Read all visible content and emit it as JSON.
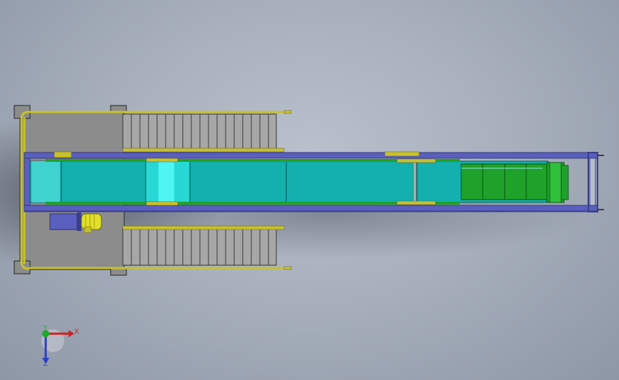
{
  "viewport": {
    "background_top": "#b9c0cc",
    "background_edge": "#8e97a6"
  },
  "model": {
    "colors": {
      "frame": "#5a5fbf",
      "frame_dark": "#3a3f8a",
      "belt": "#13b3b0",
      "belt_light": "#4ff0ee",
      "green_section": "#1fa22a",
      "green_dark": "#0f6e16",
      "rail": "#c8c22a",
      "platform": "#8a8a8a",
      "step": "#a9a9a9",
      "motor": "#e2e02a"
    }
  },
  "triad": {
    "x_label": "X",
    "y_label": "Y",
    "z_label": "Z",
    "x_color": "#d42020",
    "y_color": "#1faa2a",
    "z_color": "#2a3fc8"
  }
}
